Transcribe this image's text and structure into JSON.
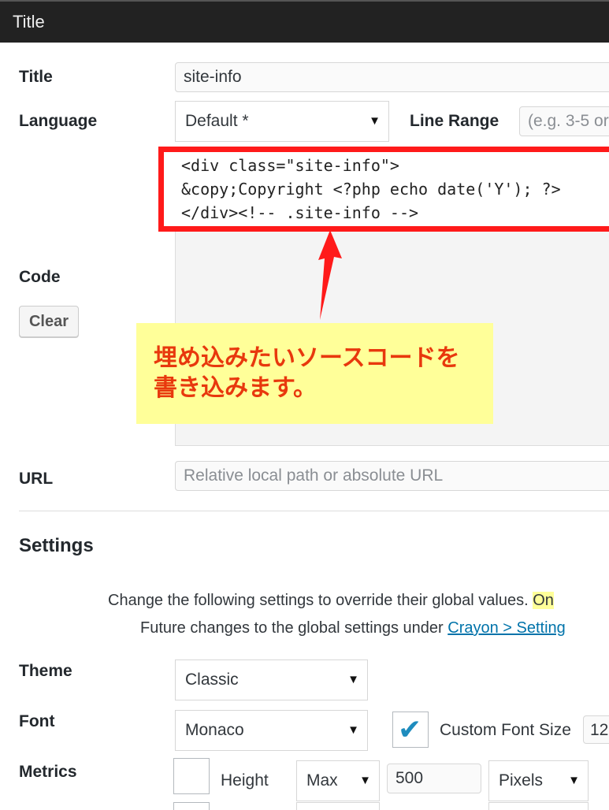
{
  "header": {
    "title": "Title"
  },
  "form": {
    "title_label": "Title",
    "title_value": "site-info",
    "language_label": "Language",
    "language_value": "Default *",
    "line_range_label": "Line Range",
    "line_range_placeholder": "(e.g. 3-5 or",
    "code_label": "Code",
    "clear_label": "Clear",
    "code_lines": [
      "<div class=\"site-info\">",
      "&copy;Copyright <?php echo date('Y'); ?>",
      "</div><!-- .site-info -->"
    ],
    "url_label": "URL",
    "url_placeholder": "Relative local path or absolute URL"
  },
  "annotation": {
    "line1": "埋め込みたいソースコードを",
    "line2": "書き込みます。",
    "highlight_color": "#ffff99",
    "box_color": "#ff1a1a",
    "text_color": "#e8380d"
  },
  "settings": {
    "heading": "Settings",
    "desc_line1": "Change the following settings to override their global values.",
    "desc_line1_highlight": "On",
    "desc_line2_prefix": "Future changes to the global settings under",
    "desc_line2_link": "Crayon > Setting",
    "theme_label": "Theme",
    "theme_value": "Classic",
    "font_label": "Font",
    "font_value": "Monaco",
    "custom_font_size_checked": true,
    "custom_font_size_label": "Custom Font Size",
    "custom_font_size_value": "12",
    "metrics_label": "Metrics",
    "height_checked": false,
    "height_label": "Height",
    "height_mode": "Max",
    "height_value": "500",
    "height_unit": "Pixels"
  },
  "icons": {
    "dropdown": "triangle-down-icon",
    "check": "checkmark-icon",
    "arrow": "red-arrow-up-icon"
  }
}
